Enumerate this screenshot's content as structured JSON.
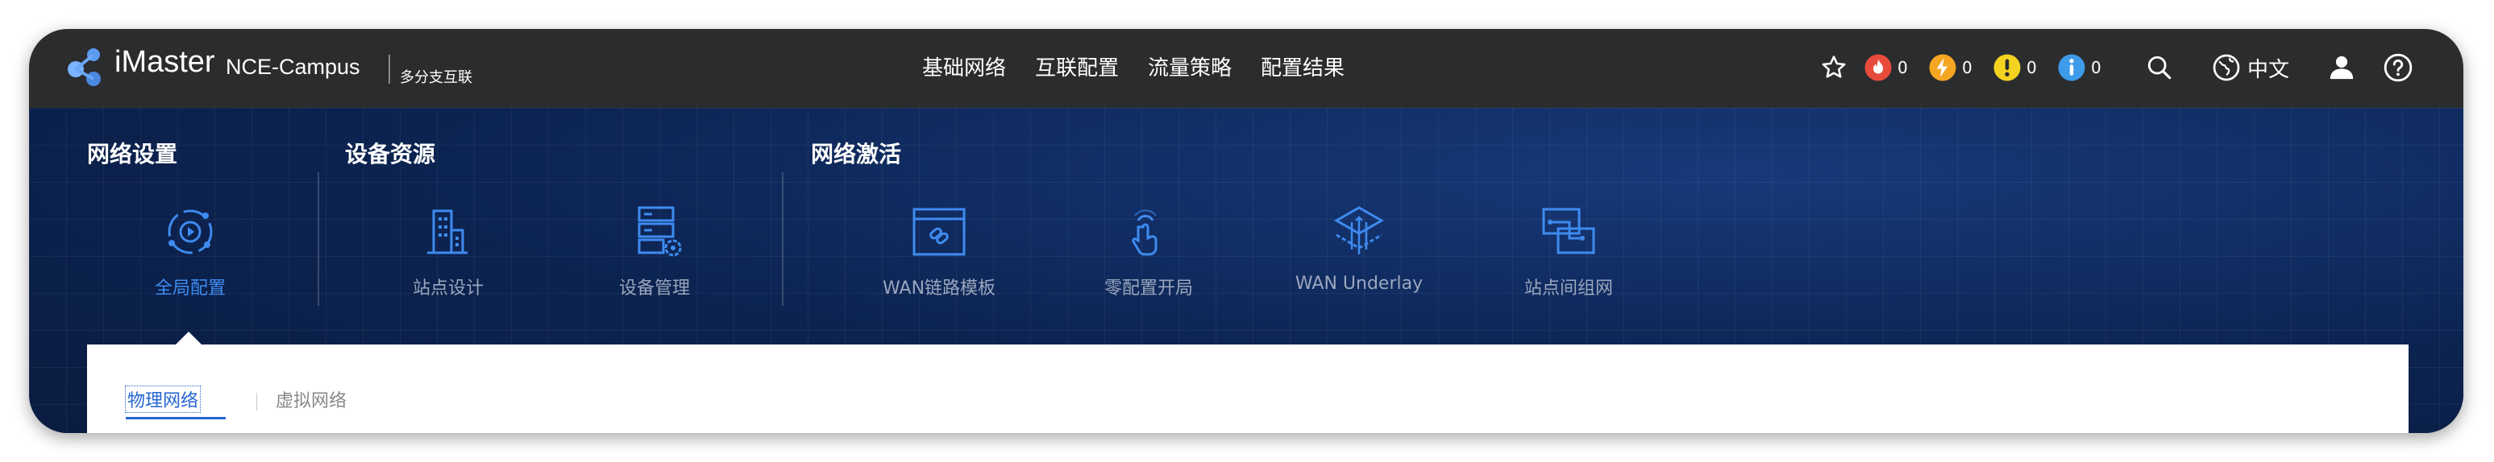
{
  "header": {
    "brand": "iMaster",
    "product": "NCE-Campus",
    "subtitle": "多分支互联",
    "nav": [
      "基础网络",
      "互联配置",
      "流量策略",
      "配置结果"
    ],
    "alarms": [
      {
        "icon": "fire-icon",
        "count": "0",
        "color": "#e84b3c"
      },
      {
        "icon": "lightning-icon",
        "count": "0",
        "color": "#f5a623"
      },
      {
        "icon": "exclamation-icon",
        "count": "0",
        "color": "#f3d31f"
      },
      {
        "icon": "info-icon",
        "count": "0",
        "color": "#3d9be9"
      }
    ],
    "language": "中文"
  },
  "hero": {
    "sections": [
      "网络设置",
      "设备资源",
      "网络激活"
    ],
    "items": [
      {
        "label": "全局配置",
        "icon": "global-config-icon",
        "active": true
      },
      {
        "label": "站点设计",
        "icon": "site-design-icon"
      },
      {
        "label": "设备管理",
        "icon": "device-management-icon"
      },
      {
        "label": "WAN链路模板",
        "icon": "wan-link-template-icon"
      },
      {
        "label": "零配置开局",
        "icon": "zero-touch-icon"
      },
      {
        "label": "WAN Underlay",
        "icon": "wan-underlay-icon"
      },
      {
        "label": "站点间组网",
        "icon": "site-networking-icon"
      }
    ]
  },
  "tabs": [
    "物理网络",
    "虚拟网络"
  ],
  "colors": {
    "accent": "#3e8bf0",
    "topbar": "#2b2c2e",
    "hero": "#0c2350"
  }
}
